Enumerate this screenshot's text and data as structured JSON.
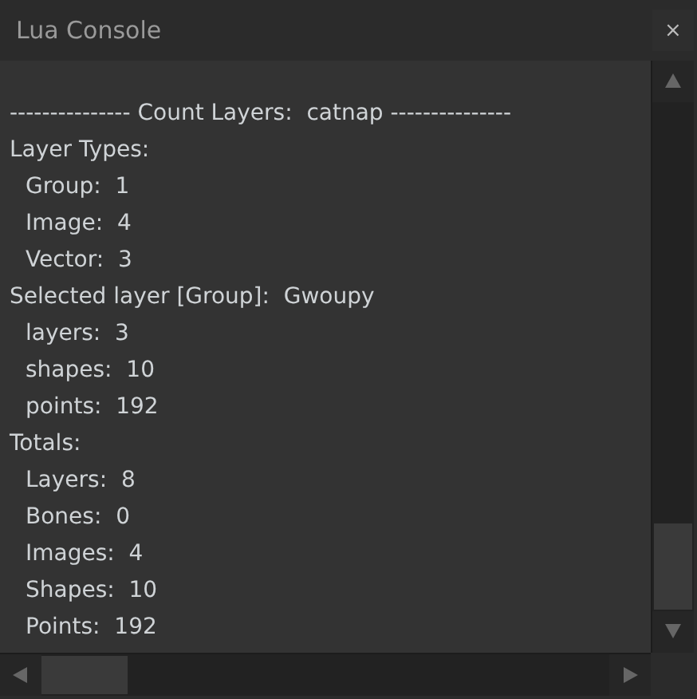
{
  "window": {
    "title": "Lua Console",
    "close": "×"
  },
  "console": {
    "header": "--------------- Count Layers:  catnap ---------------",
    "lines": [
      {
        "text": "Layer Types:",
        "children": [
          {
            "text": "Group:  1"
          },
          {
            "text": "Image:  4"
          },
          {
            "text": "Vector:  3"
          }
        ]
      },
      {
        "text": "Selected layer [Group]:  Gwoupy",
        "children": [
          {
            "text": "layers:  3"
          },
          {
            "text": "shapes:  10"
          },
          {
            "text": "points:  192"
          }
        ]
      },
      {
        "text": "Totals:",
        "children": [
          {
            "text": "Layers:  8"
          },
          {
            "text": "Bones:  0"
          },
          {
            "text": "Images:  4"
          },
          {
            "text": "Shapes:  10"
          },
          {
            "text": "Points:  192"
          }
        ]
      }
    ]
  }
}
